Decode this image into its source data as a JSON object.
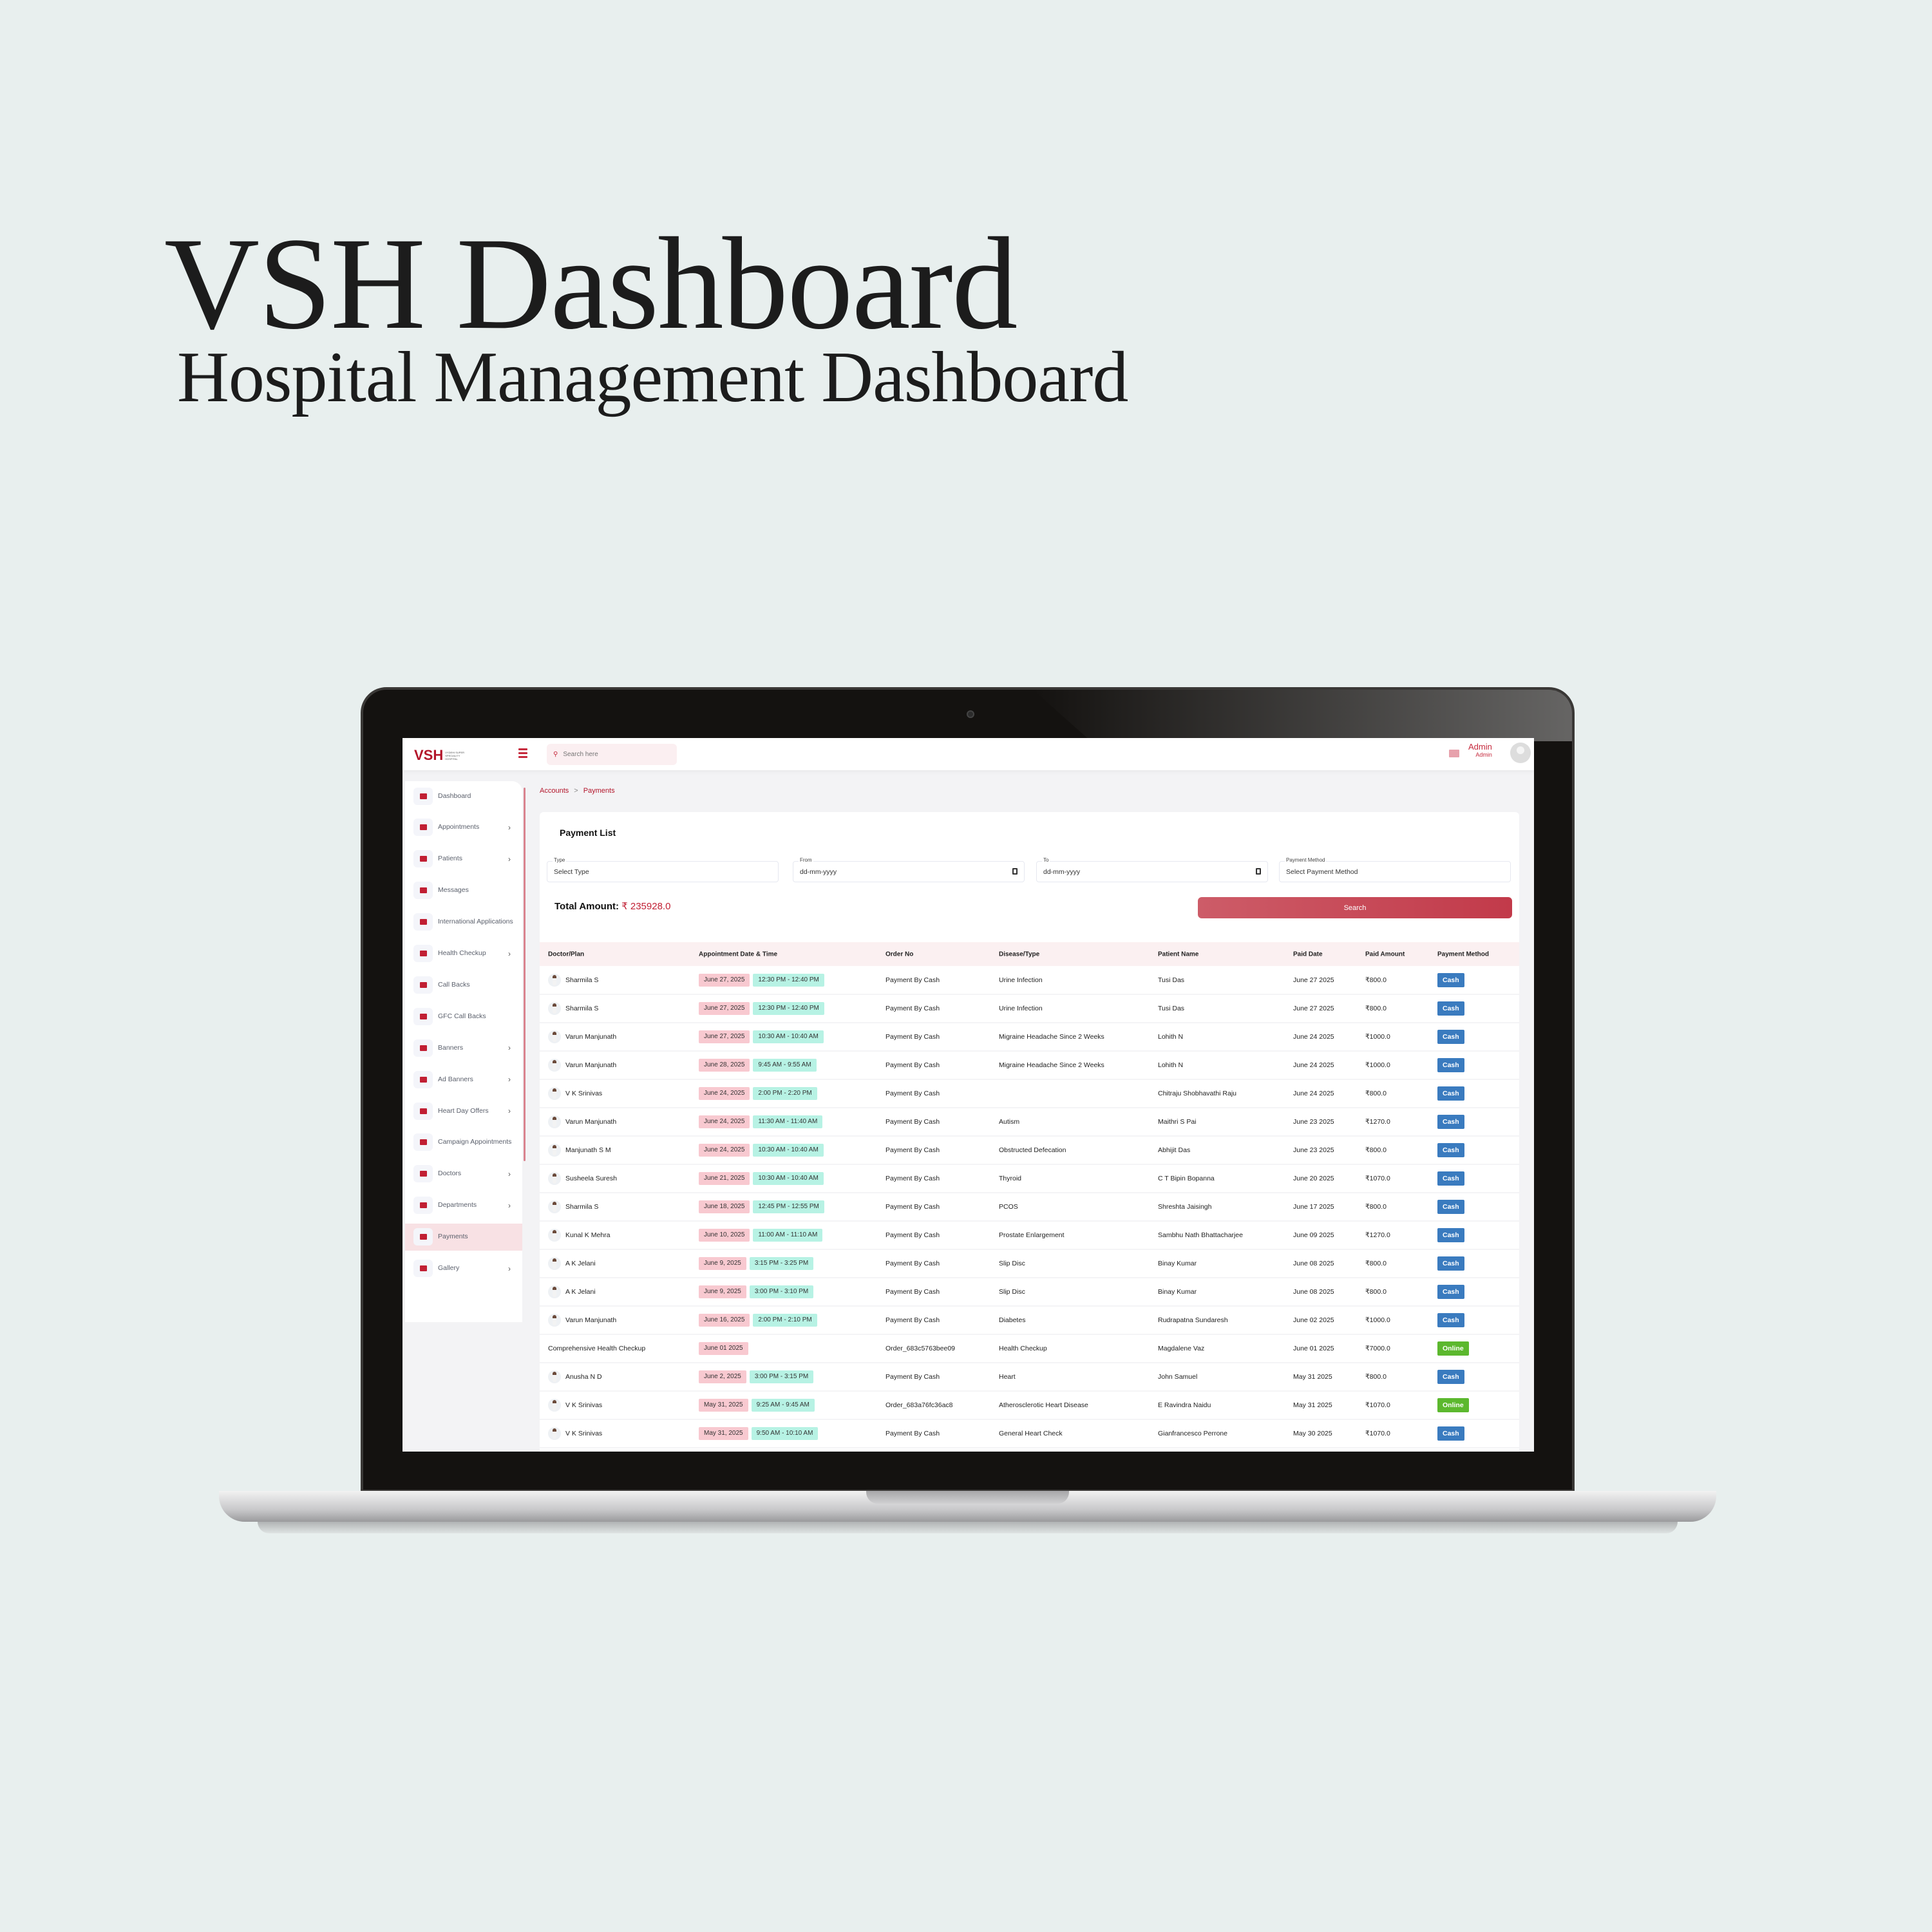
{
  "hero": {
    "title": "VSH Dashboard",
    "subtitle": "Hospital Management Dashboard"
  },
  "app": {
    "logo": "VSH",
    "logo_sub": "VYDEHI SUPER SPECIALITY HOSPITAL",
    "search_placeholder": "Search here",
    "user_name": "Admin",
    "user_role": "Admin",
    "accent": "#c11f33"
  },
  "sidebar": {
    "items": [
      {
        "label": "Dashboard",
        "chevron": false
      },
      {
        "label": "Appointments",
        "chevron": true
      },
      {
        "label": "Patients",
        "chevron": true
      },
      {
        "label": "Messages",
        "chevron": false
      },
      {
        "label": "International Applications",
        "chevron": false
      },
      {
        "label": "Health Checkup",
        "chevron": true
      },
      {
        "label": "Call Backs",
        "chevron": false
      },
      {
        "label": "GFC Call Backs",
        "chevron": false
      },
      {
        "label": "Banners",
        "chevron": true
      },
      {
        "label": "Ad Banners",
        "chevron": true
      },
      {
        "label": "Heart Day Offers",
        "chevron": true
      },
      {
        "label": "Campaign Appointments",
        "chevron": false
      },
      {
        "label": "Doctors",
        "chevron": true
      },
      {
        "label": "Departments",
        "chevron": true
      },
      {
        "label": "Payments",
        "chevron": false,
        "active": true
      },
      {
        "label": "Gallery",
        "chevron": true
      }
    ]
  },
  "breadcrumb": {
    "parent": "Accounts",
    "separator": ">",
    "current": "Payments"
  },
  "payment_list": {
    "title": "Payment List",
    "filters": {
      "type": {
        "label": "Type",
        "value": "Select Type"
      },
      "from": {
        "label": "From",
        "value": "dd-mm-yyyy"
      },
      "to": {
        "label": "To",
        "value": "dd-mm-yyyy"
      },
      "method": {
        "label": "Payment Method",
        "value": "Select Payment Method"
      }
    },
    "total_label": "Total Amount:",
    "total_value": "₹ 235928.0",
    "search_label": "Search"
  },
  "table": {
    "columns": [
      "Doctor/Plan",
      "Appointment Date & Time",
      "Order No",
      "Disease/Type",
      "Patient Name",
      "Paid Date",
      "Paid Amount",
      "Payment Method"
    ],
    "method_colors": {
      "Cash": "#3a7bbf",
      "Online": "#5cb82e"
    },
    "rows": [
      {
        "doctor": "Sharmila S",
        "avatar": true,
        "date": "June 27, 2025",
        "time": "12:30 PM - 12:40 PM",
        "order": "Payment By Cash",
        "disease": "Urine Infection",
        "patient": "Tusi Das",
        "paid_date": "June 27 2025",
        "amount": "₹800.0",
        "method": "Cash"
      },
      {
        "doctor": "Sharmila S",
        "avatar": true,
        "date": "June 27, 2025",
        "time": "12:30 PM - 12:40 PM",
        "order": "Payment By Cash",
        "disease": "Urine Infection",
        "patient": "Tusi Das",
        "paid_date": "June 27 2025",
        "amount": "₹800.0",
        "method": "Cash"
      },
      {
        "doctor": "Varun Manjunath",
        "avatar": true,
        "date": "June 27, 2025",
        "time": "10:30 AM - 10:40 AM",
        "order": "Payment By Cash",
        "disease": "Migraine Headache Since 2 Weeks",
        "patient": "Lohith N",
        "paid_date": "June 24 2025",
        "amount": "₹1000.0",
        "method": "Cash"
      },
      {
        "doctor": "Varun Manjunath",
        "avatar": true,
        "date": "June 28, 2025",
        "time": "9:45 AM - 9:55 AM",
        "order": "Payment By Cash",
        "disease": "Migraine Headache Since 2 Weeks",
        "patient": "Lohith N",
        "paid_date": "June 24 2025",
        "amount": "₹1000.0",
        "method": "Cash"
      },
      {
        "doctor": "V K Srinivas",
        "avatar": true,
        "date": "June 24, 2025",
        "time": "2:00 PM - 2:20 PM",
        "order": "Payment By Cash",
        "disease": "",
        "patient": "Chitraju Shobhavathi Raju",
        "paid_date": "June 24 2025",
        "amount": "₹800.0",
        "method": "Cash"
      },
      {
        "doctor": "Varun Manjunath",
        "avatar": true,
        "date": "June 24, 2025",
        "time": "11:30 AM - 11:40 AM",
        "order": "Payment By Cash",
        "disease": "Autism",
        "patient": "Maithri S Pai",
        "paid_date": "June 23 2025",
        "amount": "₹1270.0",
        "method": "Cash"
      },
      {
        "doctor": "Manjunath S M",
        "avatar": true,
        "date": "June 24, 2025",
        "time": "10:30 AM - 10:40 AM",
        "order": "Payment By Cash",
        "disease": "Obstructed Defecation",
        "patient": "Abhijit Das",
        "paid_date": "June 23 2025",
        "amount": "₹800.0",
        "method": "Cash"
      },
      {
        "doctor": "Susheela Suresh",
        "avatar": true,
        "date": "June 21, 2025",
        "time": "10:30 AM - 10:40 AM",
        "order": "Payment By Cash",
        "disease": "Thyroid",
        "patient": "C T Bipin Bopanna",
        "paid_date": "June 20 2025",
        "amount": "₹1070.0",
        "method": "Cash"
      },
      {
        "doctor": "Sharmila S",
        "avatar": true,
        "date": "June 18, 2025",
        "time": "12:45 PM - 12:55 PM",
        "order": "Payment By Cash",
        "disease": "PCOS",
        "patient": "Shreshta Jaisingh",
        "paid_date": "June 17 2025",
        "amount": "₹800.0",
        "method": "Cash"
      },
      {
        "doctor": "Kunal K Mehra",
        "avatar": true,
        "date": "June 10, 2025",
        "time": "11:00 AM - 11:10 AM",
        "order": "Payment By Cash",
        "disease": "Prostate Enlargement",
        "patient": "Sambhu Nath Bhattacharjee",
        "paid_date": "June 09 2025",
        "amount": "₹1270.0",
        "method": "Cash"
      },
      {
        "doctor": "A K Jelani",
        "avatar": true,
        "date": "June 9, 2025",
        "time": "3:15 PM - 3:25 PM",
        "order": "Payment By Cash",
        "disease": "Slip Disc",
        "patient": "Binay Kumar",
        "paid_date": "June 08 2025",
        "amount": "₹800.0",
        "method": "Cash"
      },
      {
        "doctor": "A K Jelani",
        "avatar": true,
        "date": "June 9, 2025",
        "time": "3:00 PM - 3:10 PM",
        "order": "Payment By Cash",
        "disease": "Slip Disc",
        "patient": "Binay Kumar",
        "paid_date": "June 08 2025",
        "amount": "₹800.0",
        "method": "Cash"
      },
      {
        "doctor": "Varun Manjunath",
        "avatar": true,
        "date": "June 16, 2025",
        "time": "2:00 PM - 2:10 PM",
        "order": "Payment By Cash",
        "disease": "Diabetes",
        "patient": "Rudrapatna Sundaresh",
        "paid_date": "June 02 2025",
        "amount": "₹1000.0",
        "method": "Cash"
      },
      {
        "doctor": "Comprehensive Health Checkup",
        "avatar": false,
        "date": "June 01 2025",
        "time": "",
        "order": "Order_683c5763bee09",
        "disease": "Health Checkup",
        "patient": "Magdalene Vaz",
        "paid_date": "June 01 2025",
        "amount": "₹7000.0",
        "method": "Online"
      },
      {
        "doctor": "Anusha N D",
        "avatar": true,
        "date": "June 2, 2025",
        "time": "3:00 PM - 3:15 PM",
        "order": "Payment By Cash",
        "disease": "Heart",
        "patient": "John Samuel",
        "paid_date": "May 31 2025",
        "amount": "₹800.0",
        "method": "Cash"
      },
      {
        "doctor": "V K Srinivas",
        "avatar": true,
        "date": "May 31, 2025",
        "time": "9:25 AM - 9:45 AM",
        "order": "Order_683a76fc36ac8",
        "disease": "Atherosclerotic Heart Disease",
        "patient": "E Ravindra Naidu",
        "paid_date": "May 31 2025",
        "amount": "₹1070.0",
        "method": "Online"
      },
      {
        "doctor": "V K Srinivas",
        "avatar": true,
        "date": "May 31, 2025",
        "time": "9:50 AM - 10:10 AM",
        "order": "Payment By Cash",
        "disease": "General Heart Check",
        "patient": "Gianfrancesco Perrone",
        "paid_date": "May 30 2025",
        "amount": "₹1070.0",
        "method": "Cash"
      }
    ]
  }
}
